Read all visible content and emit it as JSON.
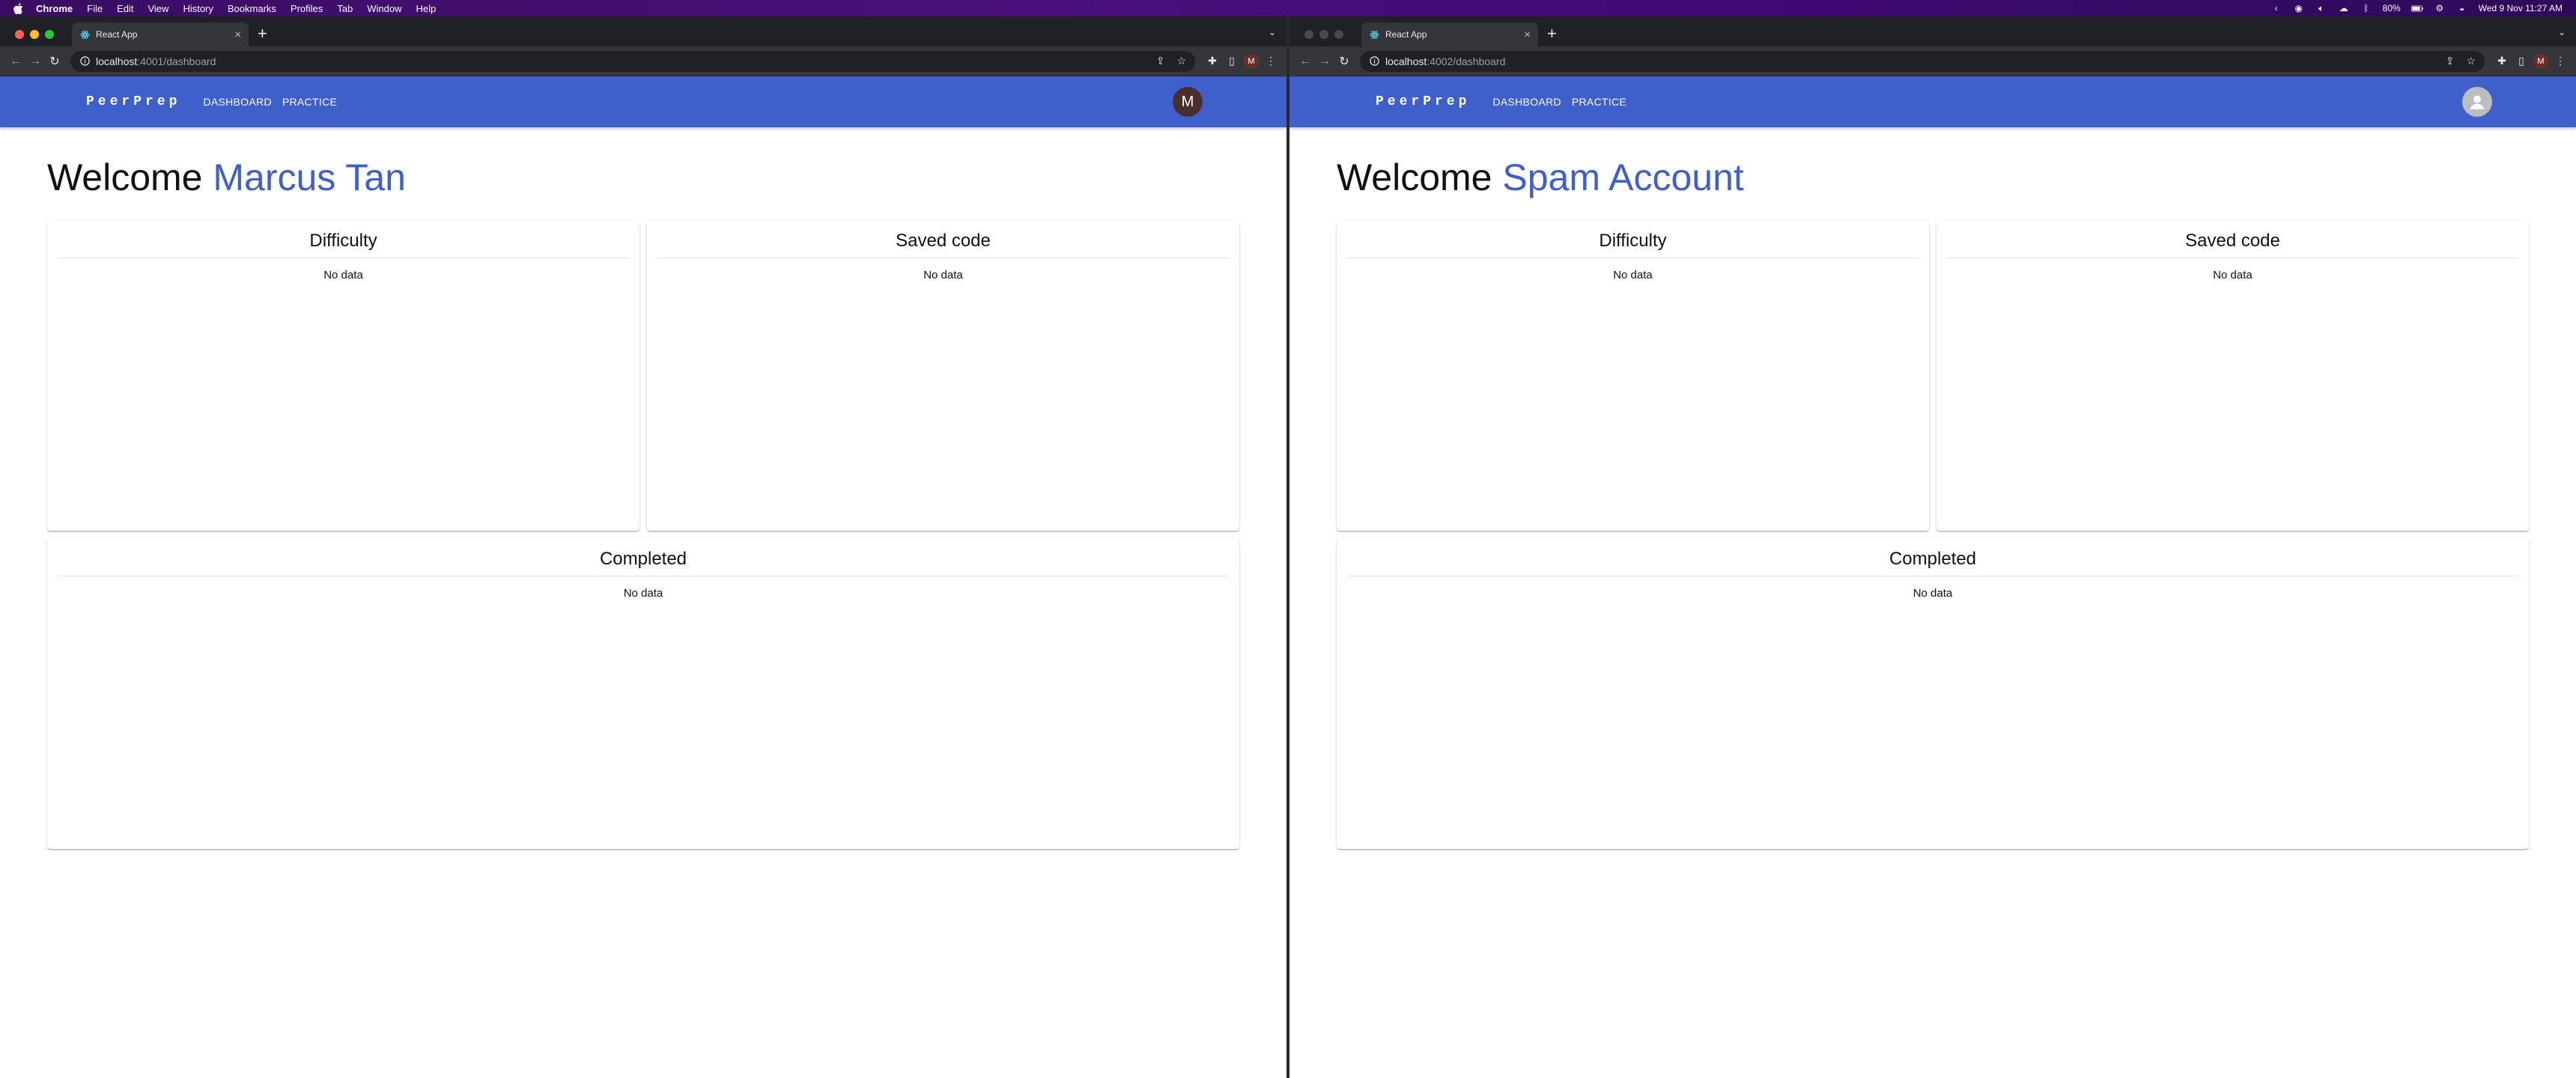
{
  "menubar": {
    "app": "Chrome",
    "items": [
      "File",
      "Edit",
      "View",
      "History",
      "Bookmarks",
      "Profiles",
      "Tab",
      "Window",
      "Help"
    ],
    "battery": "80%",
    "datetime": "Wed 9 Nov  11:27 AM"
  },
  "left": {
    "tab_title": "React App",
    "url_host": "localhost",
    "url_path": ":4001/dashboard",
    "profile_initial": "M",
    "brand": "PeerPrep",
    "nav": [
      "DASHBOARD",
      "PRACTICE"
    ],
    "avatar_initial": "M",
    "welcome": "Welcome",
    "user_name": "Marcus Tan",
    "cards": {
      "difficulty": {
        "title": "Difficulty",
        "empty": "No data"
      },
      "saved_code": {
        "title": "Saved code",
        "empty": "No data"
      },
      "completed": {
        "title": "Completed",
        "empty": "No data"
      }
    }
  },
  "right": {
    "tab_title": "React App",
    "url_host": "localhost",
    "url_path": ":4002/dashboard",
    "profile_initial": "M",
    "brand": "PeerPrep",
    "nav": [
      "DASHBOARD",
      "PRACTICE"
    ],
    "welcome": "Welcome",
    "user_name": "Spam Account",
    "cards": {
      "difficulty": {
        "title": "Difficulty",
        "empty": "No data"
      },
      "saved_code": {
        "title": "Saved code",
        "empty": "No data"
      },
      "completed": {
        "title": "Completed",
        "empty": "No data"
      }
    }
  },
  "colors": {
    "appbar": "#3f5fcb",
    "accent_name": "#3f5fcb"
  }
}
